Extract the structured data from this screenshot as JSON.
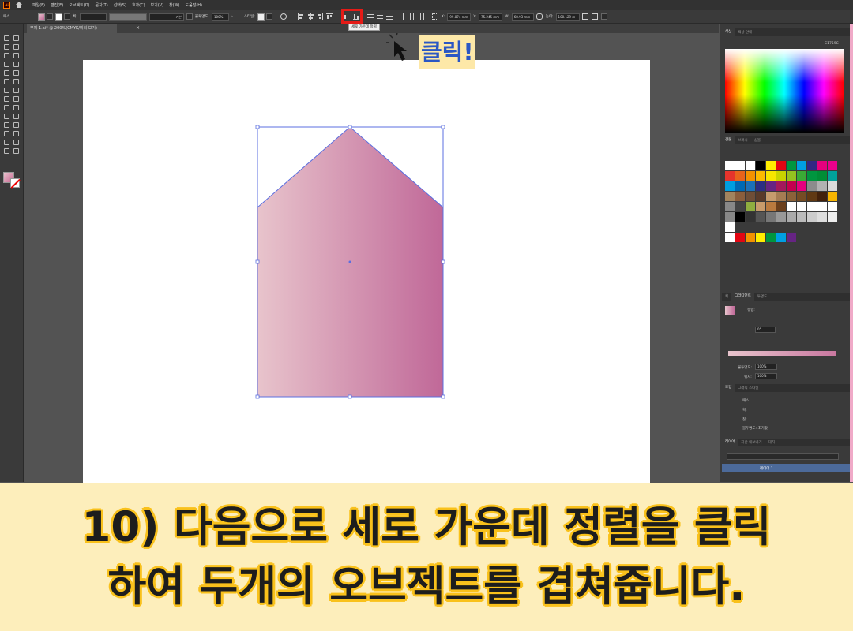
{
  "menubar": {
    "logo": "Ai",
    "items": [
      "파일(F)",
      "편집(E)",
      "오브젝트(O)",
      "문자(T)",
      "선택(S)",
      "효과(C)",
      "보기(V)",
      "창(W)",
      "도움말(H)"
    ]
  },
  "controlbar": {
    "object_type": "패스",
    "stroke_label": "획:",
    "stroke_style": "기본",
    "opacity_label": "불투명도:",
    "opacity_value": "100%",
    "style_label": "스타일:",
    "x_label": "X:",
    "x_value": "99.874 mm",
    "y_label": "Y:",
    "y_value": "75.245 mm",
    "w_label": "W:",
    "w_value": "68.93 mm",
    "h_label": "높이:",
    "h_value": "100.129 m"
  },
  "tooltip": "세로 가운데 정렬",
  "document_tab": {
    "title": "무제-1.ai* @ 200%(CMYK/미리 보기)",
    "close": "×"
  },
  "callout": {
    "label": "클릭!"
  },
  "panels": {
    "color": {
      "tabs": [
        "색상",
        "색상 안내"
      ],
      "hex": "C1759C"
    },
    "swatches": {
      "tabs": [
        "견본",
        "브러시",
        "심볼"
      ]
    },
    "gradient": {
      "tabs": [
        "획",
        "그라디언트",
        "투명도"
      ],
      "type_label": "유형:",
      "angle_value": "0°",
      "opacity_label": "불투명도:",
      "opacity_value": "100%",
      "location_label": "위치:",
      "location_value": "100%"
    },
    "appearance": {
      "tabs": [
        "모양",
        "그래픽 스타일"
      ],
      "rows": [
        "패스",
        "획:",
        "칠:",
        "불투명도: 초기값"
      ]
    },
    "layers": {
      "tabs": [
        "레이어",
        "자산 내보내기",
        "대지"
      ],
      "layer_name": "레이어 1"
    }
  },
  "caption": {
    "line1": "10) 다음으로 세로 가운데 정렬을 클릭",
    "line2": "하여 두개의 오브젝트를 겹쳐줍니다."
  },
  "colors": {
    "gradient_start": "#e8c4cc",
    "gradient_end": "#c06898",
    "selection": "#5b6fe0",
    "highlight": "#e41b17",
    "caption_bg": "#fdeebb",
    "caption_outline": "#f9c11b",
    "callout_text": "#2b57c4"
  }
}
